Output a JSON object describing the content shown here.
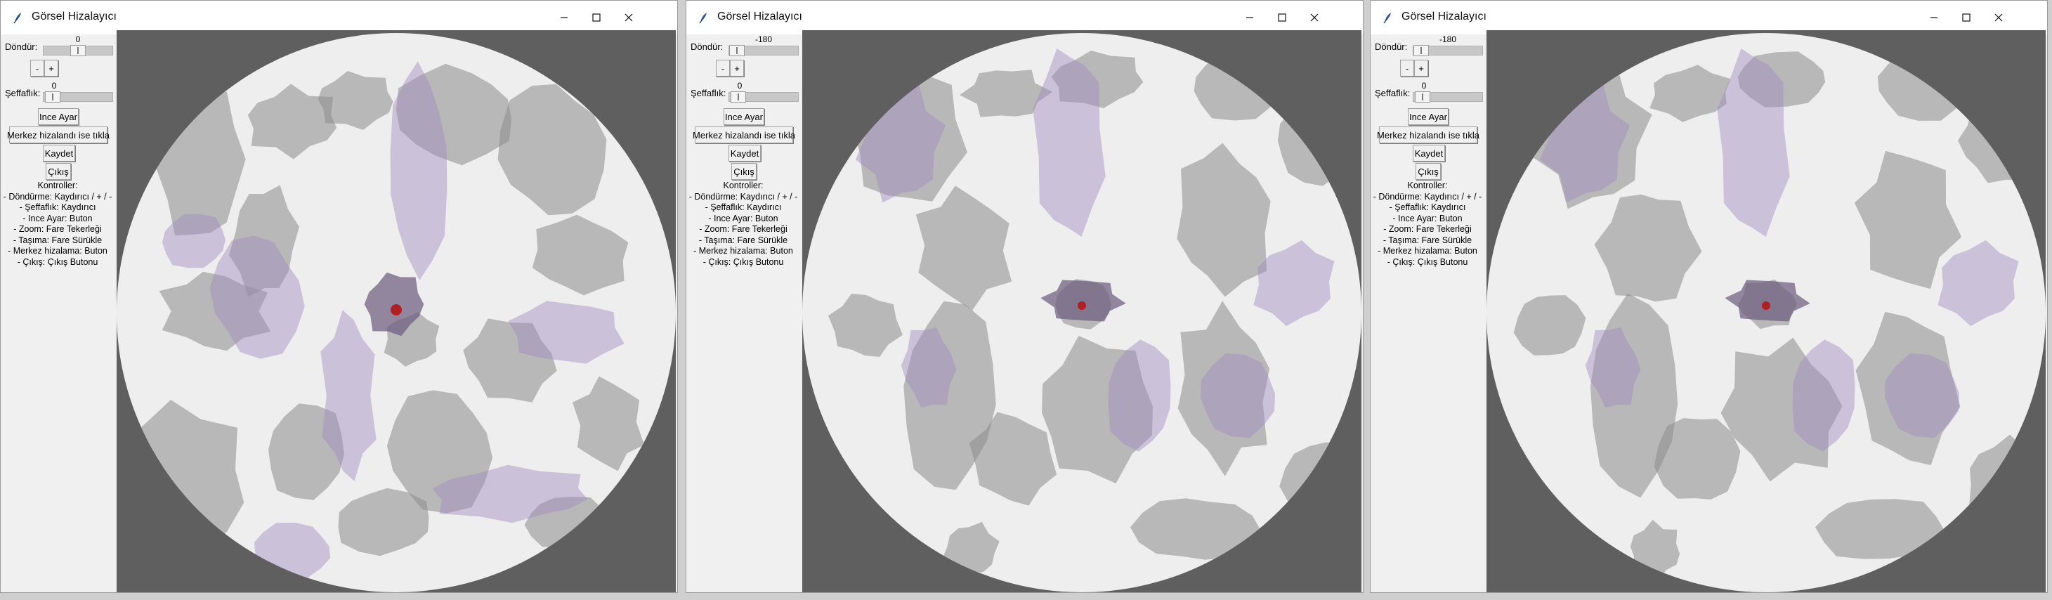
{
  "windows": [
    {
      "title": "Görsel Hizalayıcı",
      "rotate_label": "Döndür:",
      "rotate_value": "0",
      "rotate_level": 0.5,
      "minus_label": "-",
      "plus_label": "+",
      "opacity_label": "Şeffaflık:",
      "opacity_value": "0",
      "opacity_level": 0.0,
      "fine_tune_label": "Ince Ayar",
      "center_label": "Merkez hizalandı ise tıkla",
      "save_label": "Kaydet",
      "exit_label": "Çıkış",
      "controls_title": "Kontroller:",
      "controls_lines": [
        "- Döndürme: Kaydırıcı / + / -",
        "- Şeffaflık: Kaydırıcı",
        "- Ince Ayar: Buton",
        "- Zoom: Fare Tekerleği",
        "- Taşıma: Fare Sürükle",
        "- Merkez hizalama: Buton",
        "- Çıkış: Çıkış Butonu"
      ]
    },
    {
      "title": "Görsel Hizalayıcı",
      "rotate_label": "Döndür:",
      "rotate_value": "-180",
      "rotate_level": 0.0,
      "minus_label": "-",
      "plus_label": "+",
      "opacity_label": "Şeffaflık:",
      "opacity_value": "0",
      "opacity_level": 0.0,
      "fine_tune_label": "Ince Ayar",
      "center_label": "Merkez hizalandı ise tıkla",
      "save_label": "Kaydet",
      "exit_label": "Çıkış",
      "controls_title": "Kontroller:",
      "controls_lines": [
        "- Döndürme: Kaydırıcı / + / -",
        "- Şeffaflık: Kaydırıcı",
        "- Ince Ayar: Buton",
        "- Zoom: Fare Tekerleği",
        "- Taşıma: Fare Sürükle",
        "- Merkez hizalama: Buton",
        "- Çıkış: Çıkış Butonu"
      ]
    },
    {
      "title": "Görsel Hizalayıcı",
      "rotate_label": "Döndür:",
      "rotate_value": "-180",
      "rotate_level": 0.0,
      "minus_label": "-",
      "plus_label": "+",
      "opacity_label": "Şeffaflık:",
      "opacity_value": "0",
      "opacity_level": 0.0,
      "fine_tune_label": "Ince Ayar",
      "center_label": "Merkez hizalandı ise tıkla",
      "save_label": "Kaydet",
      "exit_label": "Çıkış",
      "controls_title": "Kontroller:",
      "controls_lines": [
        "- Döndürme: Kaydırıcı / + / -",
        "- Şeffaflık: Kaydırıcı",
        "- Ince Ayar: Buton",
        "- Zoom: Fare Tekerleği",
        "- Taşıma: Fare Sürükle",
        "- Merkez hizalama: Buton",
        "- Çıkış: Çıkış Butonu"
      ]
    }
  ],
  "colors": {
    "canvas_background": "#5f5f5f",
    "slide_background": "#eeeeee",
    "tissue_gray": "#8c8c8c",
    "tissue_purple": "#a08cc0",
    "marker_red": "#b02020"
  },
  "icons": {
    "app": "feather-icon",
    "minimize": "minimize-icon",
    "maximize": "maximize-icon",
    "close": "close-icon"
  }
}
